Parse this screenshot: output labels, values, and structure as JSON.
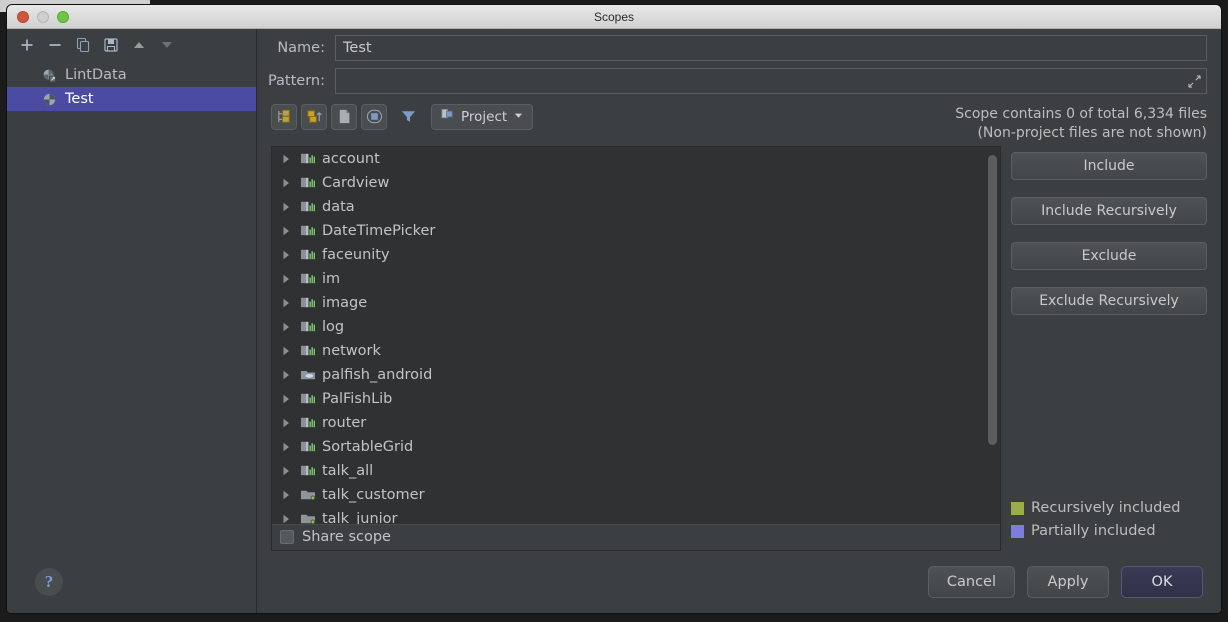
{
  "window": {
    "title": "Scopes",
    "traffic_lights": [
      "close-button",
      "minimize-button",
      "zoom-button"
    ]
  },
  "left_panel": {
    "toolbar": [
      {
        "name": "add-scope-button",
        "glyph": "+"
      },
      {
        "name": "remove-scope-button",
        "glyph": "−"
      },
      {
        "name": "copy-scope-button",
        "glyph": "copy-icon"
      },
      {
        "name": "save-scope-button",
        "glyph": "save-icon"
      },
      {
        "name": "move-up-button",
        "glyph": "triangle-up-icon"
      },
      {
        "name": "move-down-button",
        "glyph": "triangle-down-icon"
      }
    ],
    "scopes": [
      {
        "label": "LintData",
        "icon": "shared-scope-icon",
        "selected": false
      },
      {
        "label": "Test",
        "icon": "scope-icon",
        "selected": true
      }
    ],
    "help_label": "?"
  },
  "form": {
    "name_label": "Name:",
    "name_value": "Test",
    "name_placeholder": "",
    "pattern_label": "Pattern:",
    "pattern_value": "",
    "pattern_placeholder": ""
  },
  "tree_toolbar": {
    "buttons": [
      {
        "name": "flatten-packages-button",
        "icon": "flatten-packages-icon"
      },
      {
        "name": "compact-middle-packages-button",
        "icon": "compact-packages-icon"
      },
      {
        "name": "show-files-button",
        "icon": "file-icon"
      },
      {
        "name": "group-by-modules-button",
        "icon": "module-group-icon"
      }
    ],
    "filter_icon": "filter-icon",
    "scope_selector": {
      "label": "Project",
      "icon": "project-icon",
      "chevron": "chevron-down-icon"
    }
  },
  "scope_info": {
    "line1": "Scope contains 0 of total 6,334 files",
    "line2": "(Non-project files are not shown)"
  },
  "tree": {
    "items": [
      {
        "label": "account",
        "icon": "module-icon"
      },
      {
        "label": "Cardview",
        "icon": "module-icon"
      },
      {
        "label": "data",
        "icon": "module-icon"
      },
      {
        "label": "DateTimePicker",
        "icon": "module-icon"
      },
      {
        "label": "faceunity",
        "icon": "module-icon"
      },
      {
        "label": "im",
        "icon": "module-icon"
      },
      {
        "label": "image",
        "icon": "module-icon"
      },
      {
        "label": "log",
        "icon": "module-icon"
      },
      {
        "label": "network",
        "icon": "module-icon"
      },
      {
        "label": "palfish_android",
        "icon": "java-module-icon"
      },
      {
        "label": "PalFishLib",
        "icon": "module-icon"
      },
      {
        "label": "router",
        "icon": "module-icon"
      },
      {
        "label": "SortableGrid",
        "icon": "module-icon"
      },
      {
        "label": "talk_all",
        "icon": "module-icon"
      },
      {
        "label": "talk_customer",
        "icon": "source-folder-icon"
      },
      {
        "label": "talk_junior",
        "icon": "source-folder-icon"
      }
    ],
    "share_scope_label": "Share scope",
    "share_scope_checked": false
  },
  "action_buttons": [
    {
      "name": "include-button",
      "label": "Include"
    },
    {
      "name": "include-recursively-button",
      "label": "Include Recursively"
    },
    {
      "name": "exclude-button",
      "label": "Exclude"
    },
    {
      "name": "exclude-recursively-button",
      "label": "Exclude Recursively"
    }
  ],
  "legend": [
    {
      "label": "Recursively included",
      "color": "#9aad4a"
    },
    {
      "label": "Partially included",
      "color": "#7b7fdb"
    }
  ],
  "footer_buttons": [
    {
      "name": "cancel-button",
      "label": "Cancel",
      "primary": false
    },
    {
      "name": "apply-button",
      "label": "Apply",
      "primary": false
    },
    {
      "name": "ok-button",
      "label": "OK",
      "primary": true
    }
  ],
  "colors": {
    "selection": "#4b4ba3",
    "window_bg": "#3c3f41",
    "tree_bg": "#2f3133",
    "text": "#bbbbbb"
  }
}
